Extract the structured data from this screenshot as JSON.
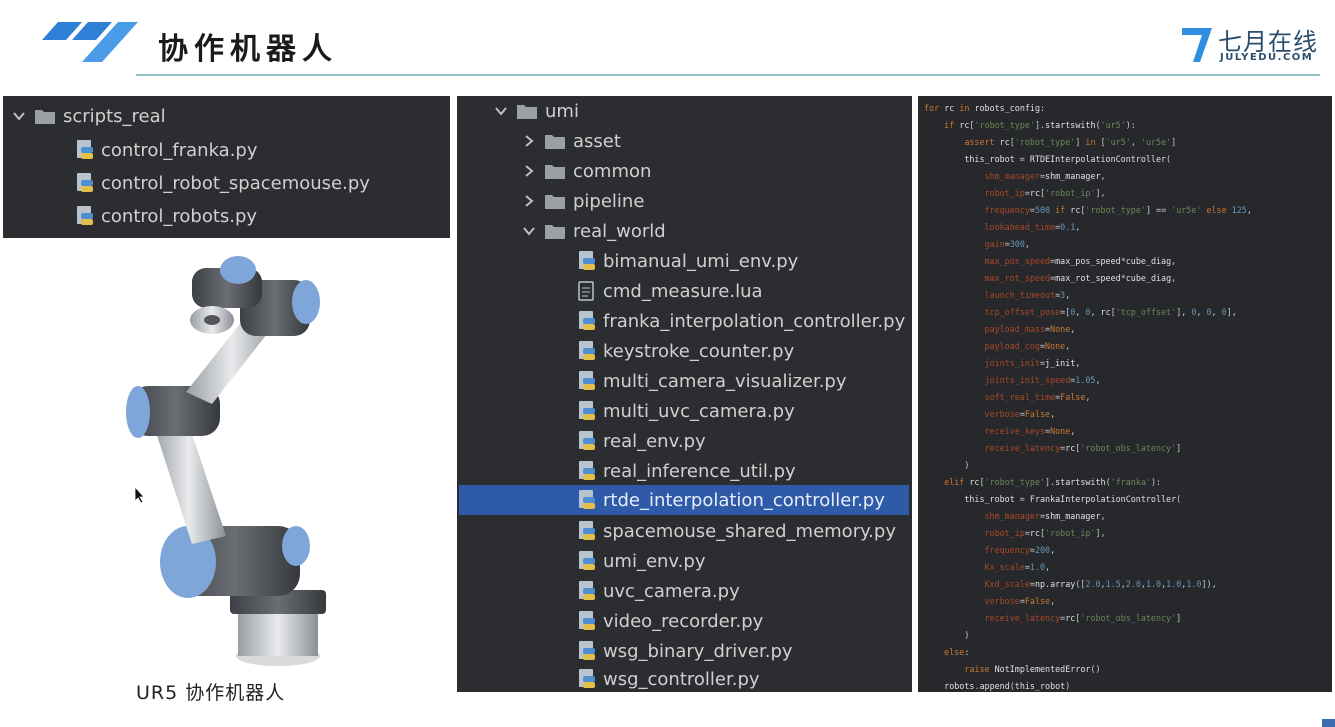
{
  "header": {
    "title": "协作机器人",
    "brand_name": "七月在线",
    "brand_sub": "JULYEDU.COM"
  },
  "colors": {
    "accent_line": "#8fc2c9",
    "logo_blue": "#2e7fd6",
    "panel_bg": "#2b2d30",
    "selection": "#2f5aa8"
  },
  "scripts_panel": {
    "folder": "scripts_real",
    "files": [
      "control_franka.py",
      "control_robot_spacemouse.py",
      "control_robots.py"
    ]
  },
  "tree_panel": {
    "root": "umi",
    "folders": [
      "asset",
      "common",
      "pipeline"
    ],
    "open_folder": "real_world",
    "files": [
      {
        "name": "bimanual_umi_env.py",
        "type": "py"
      },
      {
        "name": "cmd_measure.lua",
        "type": "lua"
      },
      {
        "name": "franka_interpolation_controller.py",
        "type": "py"
      },
      {
        "name": "keystroke_counter.py",
        "type": "py"
      },
      {
        "name": "multi_camera_visualizer.py",
        "type": "py"
      },
      {
        "name": "multi_uvc_camera.py",
        "type": "py"
      },
      {
        "name": "real_env.py",
        "type": "py"
      },
      {
        "name": "real_inference_util.py",
        "type": "py"
      },
      {
        "name": "rtde_interpolation_controller.py",
        "type": "py",
        "selected": true
      },
      {
        "name": "spacemouse_shared_memory.py",
        "type": "py"
      },
      {
        "name": "umi_env.py",
        "type": "py"
      },
      {
        "name": "uvc_camera.py",
        "type": "py"
      },
      {
        "name": "video_recorder.py",
        "type": "py"
      },
      {
        "name": "wsg_binary_driver.py",
        "type": "py"
      },
      {
        "name": "wsg_controller.py",
        "type": "py"
      }
    ]
  },
  "code_lines": [
    "for rc in robots_config:",
    "    if rc['robot_type'].startswith('ur5'):",
    "        assert rc['robot_type'] in ['ur5', 'ur5e']",
    "        this_robot = RTDEInterpolationController(",
    "            shm_manager=shm_manager,",
    "            robot_ip=rc['robot_ip'],",
    "            frequency=500 if rc['robot_type'] == 'ur5e' else 125,",
    "            lookahead_time=0.1,",
    "            gain=300,",
    "            max_pos_speed=max_pos_speed*cube_diag,",
    "            max_rot_speed=max_rot_speed*cube_diag,",
    "            launch_timeout=3,",
    "            tcp_offset_pose=[0, 0, rc['tcp_offset'], 0, 0, 0],",
    "            payload_mass=None,",
    "            payload_cog=None,",
    "            joints_init=j_init,",
    "            joints_init_speed=1.05,",
    "            soft_real_time=False,",
    "            verbose=False,",
    "            receive_keys=None,",
    "            receive_latency=rc['robot_obs_latency']",
    "        )",
    "    elif rc['robot_type'].startswith('franka'):",
    "        this_robot = FrankaInterpolationController(",
    "            shm_manager=shm_manager,",
    "            robot_ip=rc['robot_ip'],",
    "            frequency=200,",
    "            Kx_scale=1.0,",
    "            Kxd_scale=np.array([2.0,1.5,2.0,1.0,1.0,1.0]),",
    "            verbose=False,",
    "            receive_latency=rc['robot_obs_latency']",
    "        )",
    "    else:",
    "        raise NotImplementedError()",
    "    robots.append(this_robot)"
  ],
  "caption": "UR5 协作机器人"
}
